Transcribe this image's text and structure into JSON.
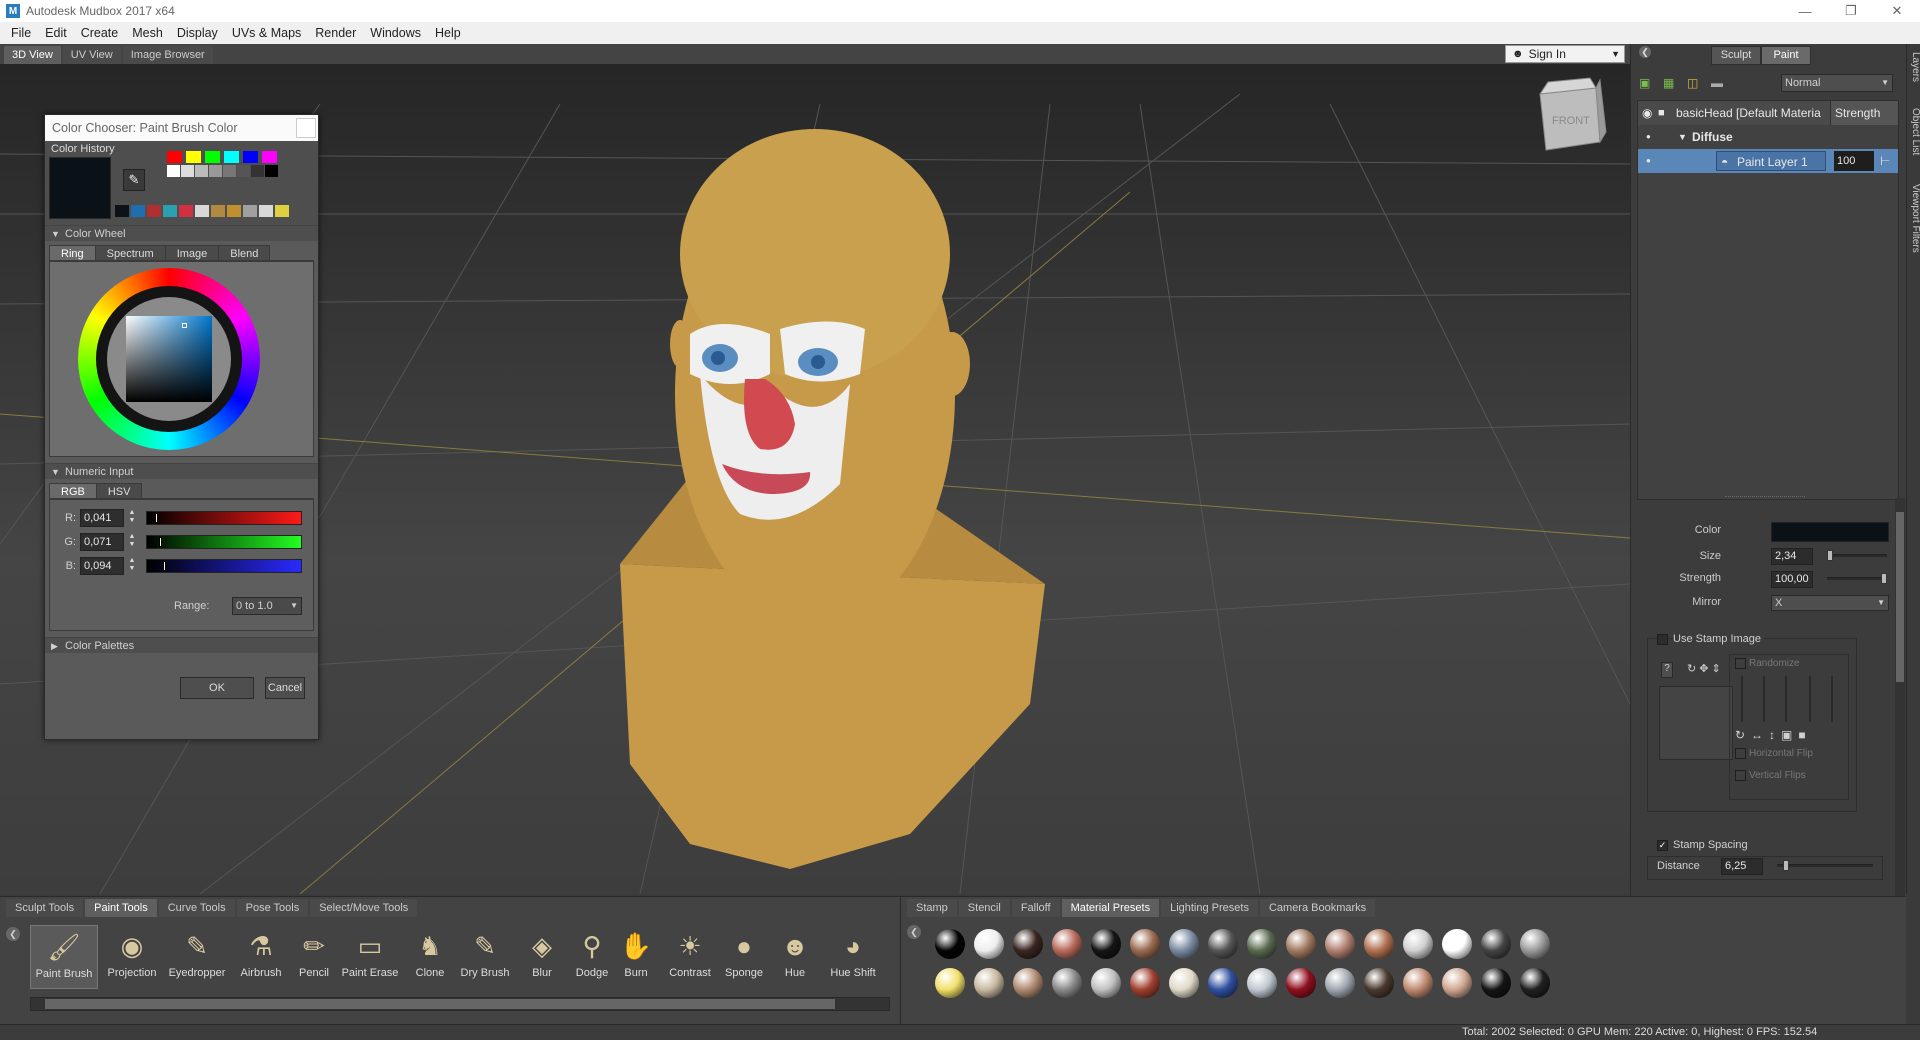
{
  "window": {
    "title": "Autodesk Mudbox 2017 x64",
    "logo": "M"
  },
  "menu": [
    "File",
    "Edit",
    "Create",
    "Mesh",
    "Display",
    "UVs & Maps",
    "Render",
    "Windows",
    "Help"
  ],
  "view_tabs": [
    "3D View",
    "UV View",
    "Image Browser"
  ],
  "signin": {
    "label": "Sign In"
  },
  "viewcube": {
    "face": "FRONT"
  },
  "color_dialog": {
    "title": "Color Chooser: Paint Brush Color",
    "history_label": "Color History",
    "history_colors_top": [
      "#ff0000",
      "#ffff00",
      "#00ff00",
      "#00ffff",
      "#0000ff",
      "#ff00ff"
    ],
    "history_colors_gray": [
      "#ffffff",
      "#dddddd",
      "#bbbbbb",
      "#999999",
      "#777777",
      "#555555",
      "#333333",
      "#000000"
    ],
    "history_colors_recent": [
      "#0d1218",
      "#1f6fb0",
      "#b03030",
      "#2aa0b0",
      "#d03040",
      "#d8d8d8",
      "#b08a40",
      "#c09030",
      "#a0a0a0",
      "#d8d8d8",
      "#e0d040"
    ],
    "current_color": "#0a1218",
    "wheel_section": "Color Wheel",
    "wheel_tabs": [
      "Ring",
      "Spectrum",
      "Image",
      "Blend"
    ],
    "numeric_section": "Numeric Input",
    "numeric_tabs": [
      "RGB",
      "HSV"
    ],
    "channels": [
      {
        "label": "R:",
        "value": "0,041",
        "fraction": 0.041,
        "gradient": "linear-gradient(90deg,#000,#ff1a1a)"
      },
      {
        "label": "G:",
        "value": "0,071",
        "fraction": 0.071,
        "gradient": "linear-gradient(90deg,#000,#22ff22)"
      },
      {
        "label": "B:",
        "value": "0,094",
        "fraction": 0.094,
        "gradient": "linear-gradient(90deg,#000,#2a2aff)"
      }
    ],
    "range_label": "Range:",
    "range_value": "0 to 1.0",
    "palettes_section": "Color Palettes",
    "ok": "OK",
    "cancel": "Cancel"
  },
  "right_panel": {
    "modes": [
      "Sculpt",
      "Paint"
    ],
    "blend_mode": "Normal",
    "object_name": "basicHead [Default Materia",
    "strength_header": "Strength",
    "channel": "Diffuse",
    "layer_name": "Paint Layer 1",
    "layer_strength": "100",
    "color_label": "Color",
    "brush_color": "#0a1218",
    "size_label": "Size",
    "size_value": "2,34",
    "strength_label": "Strength",
    "strength_value": "100,00",
    "mirror_label": "Mirror",
    "mirror_value": "X",
    "use_stamp_image": "Use Stamp Image",
    "randomize": "Randomize",
    "horizontal_flip": "Horizontal Flip",
    "vertical_flips": "Vertical Flips",
    "stamp_spacing": "Stamp Spacing",
    "distance_label": "Distance",
    "distance_value": "6,25"
  },
  "side_tabs": [
    "Layers",
    "Object List",
    "Viewport Filters"
  ],
  "tool_tabs": [
    "Sculpt Tools",
    "Paint Tools",
    "Curve Tools",
    "Pose Tools",
    "Select/Move Tools"
  ],
  "tools": [
    {
      "label": "Paint Brush",
      "icon": "paint-brush-icon",
      "active": true
    },
    {
      "label": "Projection",
      "icon": "projection-icon"
    },
    {
      "label": "Eyedropper",
      "icon": "eyedropper-icon"
    },
    {
      "label": "Airbrush",
      "icon": "airbrush-icon"
    },
    {
      "label": "Pencil",
      "icon": "pencil-icon"
    },
    {
      "label": "Paint Erase",
      "icon": "paint-erase-icon"
    },
    {
      "label": "Clone",
      "icon": "clone-icon"
    },
    {
      "label": "Dry Brush",
      "icon": "dry-brush-icon"
    },
    {
      "label": "Blur",
      "icon": "blur-icon"
    },
    {
      "label": "Dodge",
      "icon": "dodge-icon"
    },
    {
      "label": "Burn",
      "icon": "burn-icon"
    },
    {
      "label": "Contrast",
      "icon": "contrast-icon"
    },
    {
      "label": "Sponge",
      "icon": "sponge-icon"
    },
    {
      "label": "Hue",
      "icon": "hue-icon"
    },
    {
      "label": "Hue Shift",
      "icon": "hue-shift-icon"
    }
  ],
  "material_tabs": [
    "Stamp",
    "Stencil",
    "Falloff",
    "Material Presets",
    "Lighting Presets",
    "Camera Bookmarks"
  ],
  "materials_row1": [
    "#050505",
    "#eeeeee",
    "#3a2620",
    "#b86a5a",
    "#151515",
    "#9a6a50",
    "#7a8aa0",
    "#555555",
    "#5a6a50",
    "#a07a60",
    "#b08070",
    "#b07050",
    "#d0d0d0",
    "#ffffff",
    "#444444",
    "#9a9a9a"
  ],
  "materials_row2": [
    "#f2e06a",
    "#c8b8a0",
    "#b08a70",
    "#8a8a8a",
    "#c0c0c0",
    "#a04030",
    "#e0d8c8",
    "#3050a0",
    "#c0c8d0",
    "#901020",
    "#a0a8b0",
    "#4a3a30",
    "#c08a70",
    "#d0a890",
    "#151515",
    "#202020"
  ],
  "status": "Total: 2002  Selected: 0  GPU Mem: 220  Active: 0, Highest: 0  FPS: 152.54"
}
